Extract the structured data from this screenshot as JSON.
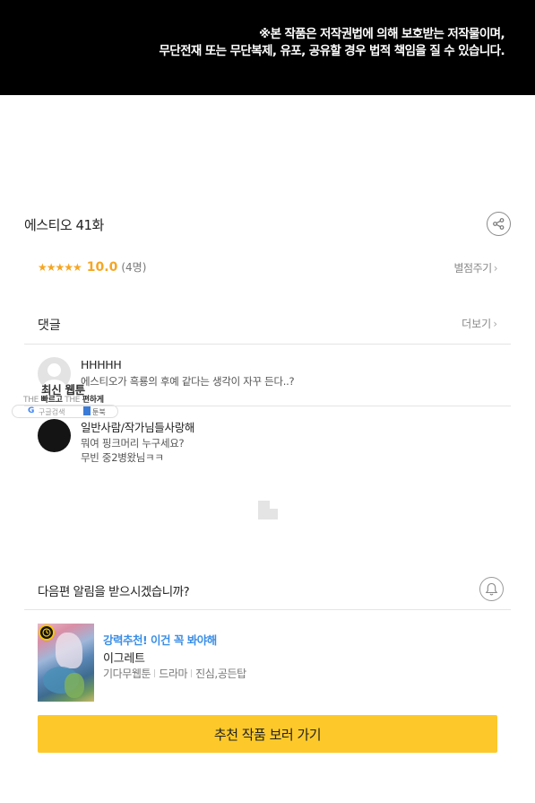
{
  "copyright": {
    "line1": "※본 작품은 저작권법에 의해 보호받는 저작물이며,",
    "line2": "무단전재 또는 무단복제, 유포, 공유할 경우 법적 책임을 질 수 있습니다."
  },
  "episode": {
    "title": "에스티오 41화",
    "share_icon": "share-icon"
  },
  "rating": {
    "stars": "★★★★★",
    "score": "10.0",
    "count": "(4명)",
    "rate_label": "별점주기",
    "star_color": "#f5a623"
  },
  "comments": {
    "title": "댓글",
    "more_label": "더보기",
    "items": [
      {
        "name": "HHHHH",
        "lines": [
          "에스티오가 흑룡의 후예 같다는 생각이 자꾸 든다..?"
        ]
      },
      {
        "name": "일반사람/작가님들사랑해",
        "lines": [
          "뭐여 핑크머리 누구세요?",
          "무빈 중2병왔님ㅋㅋ"
        ]
      }
    ]
  },
  "ad_overlay": {
    "label": "최신 웹툰",
    "tagline_1": "THE ",
    "tagline_2": "빠르고",
    "tagline_3": " THE ",
    "tagline_4": "편하게",
    "search_text": "구글검색",
    "bookmark_text": "툰북"
  },
  "notify": {
    "text": "다음편 알림을 받으시겠습니까?",
    "icon": "bell-icon"
  },
  "recommendation": {
    "label": "강력추천! 이건 꼭 봐야해",
    "title": "이그레트",
    "tags": [
      "기다무웹툰",
      "드라마",
      "진심,공든탑"
    ],
    "label_color": "#3a8ee6"
  },
  "cta": {
    "label": "추천 작품 보러 가기",
    "color": "#fdc92a"
  }
}
